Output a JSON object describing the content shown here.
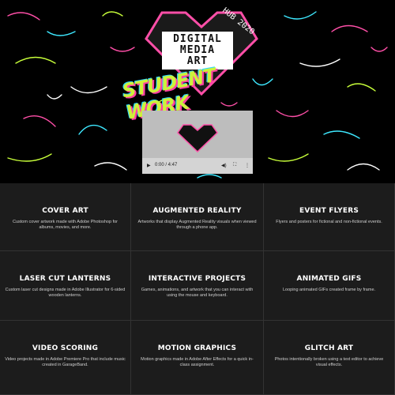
{
  "hero": {
    "logo_lines": [
      "DIGITAL",
      "MEDIA",
      "ART"
    ],
    "badge": "HUB 2020",
    "tagline": "STUDENT WORK",
    "video": {
      "time": "0:00 / 4:47"
    }
  },
  "projects": [
    {
      "title": "COVER ART",
      "description": "Custom cover artwork made with Adobe Photoshop for albums, movies, and more."
    },
    {
      "title": "AUGMENTED REALITY",
      "description": "Artworks that display Augmented Reality visuals when viewed through a phone app."
    },
    {
      "title": "EVENT FLYERS",
      "description": "Flyers and posters for fictional and non-fictional events."
    },
    {
      "title": "LASER CUT LANTERNS",
      "description": "Custom laser cut designs made in Adobe Illustrator for 6-sided wooden lanterns."
    },
    {
      "title": "INTERACTIVE PROJECTS",
      "description": "Games, animations, and artwork that you can interact with using the mouse and keyboard."
    },
    {
      "title": "ANIMATED GIFS",
      "description": "Looping animated GIFs created frame by frame."
    },
    {
      "title": "VIDEO SCORING",
      "description": "Video projects made in Adobe Premiere Pro that include music created in GarageBand."
    },
    {
      "title": "MOTION GRAPHICS",
      "description": "Motion graphics made in Adobe After Effects for a quick in-class assignment."
    },
    {
      "title": "GLITCH ART",
      "description": "Photos intentionally broken using a text editor to achieve visual effects."
    }
  ]
}
